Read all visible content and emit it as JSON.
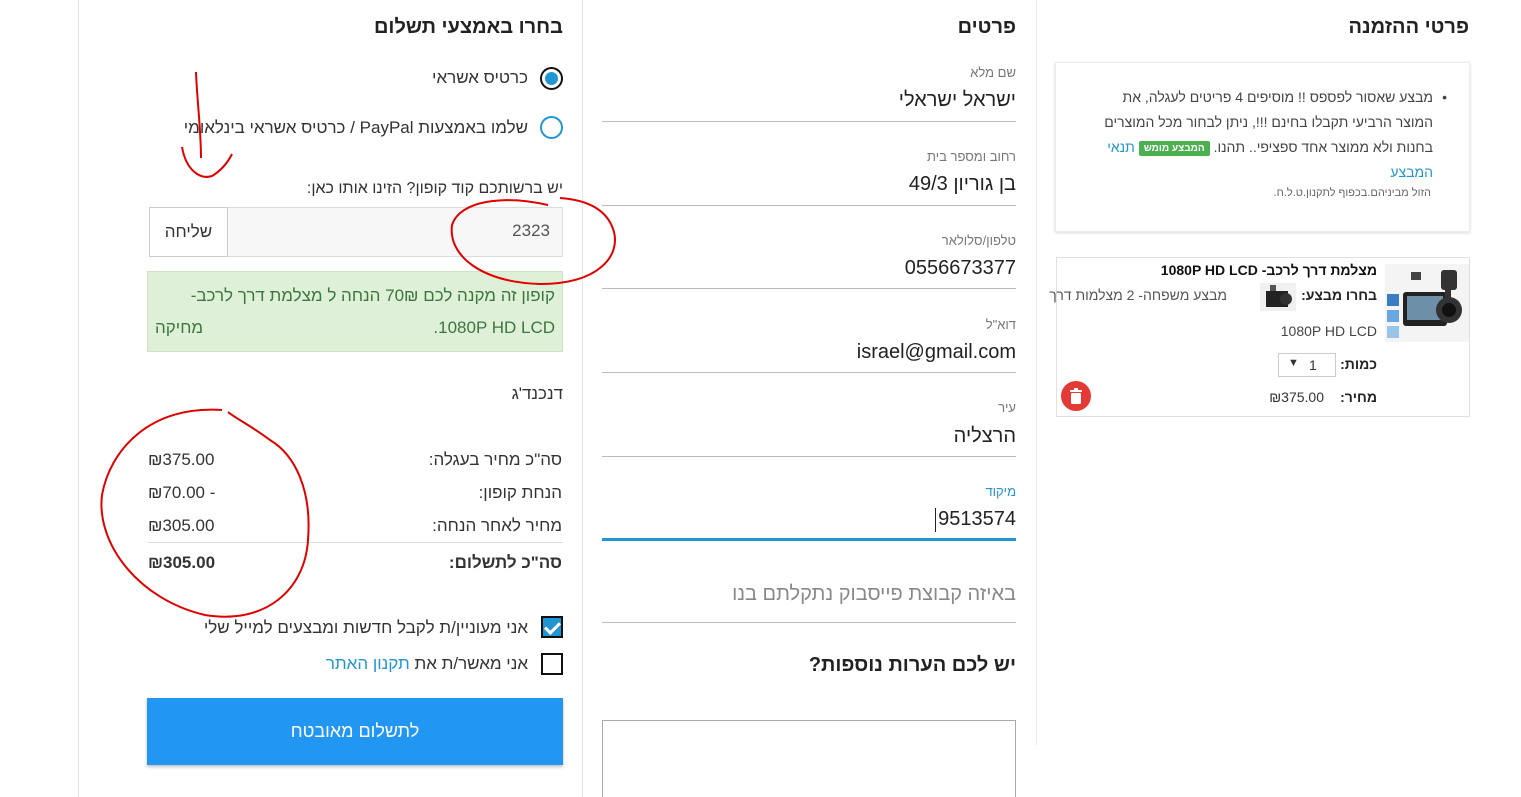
{
  "order": {
    "title": "פרטי ההזמנה",
    "promo_text": "מבצע שאסור לפספס !! מוסיפים 4 פריטים לעגלה, את המוצר הרביעי תקבלו בחינם !!!, ניתן לבחור מכל המוצרים בחנות ולא ממוצר אחד ספציפי.. תהנו.",
    "promo_badge": "המבצע מומש",
    "promo_terms_link": "תנאי המבצע",
    "promo_note": "הזול מביניהם.בכפוף לתקנון.ט.ל.ח.",
    "item": {
      "name": "מצלמת דרך לרכב- 1080P HD LCD",
      "choose_label": "בחרו מבצע:",
      "choose_value": "מבצע משפחה- 2 מצלמות דרך",
      "choose_value_2": "1080P HD LCD",
      "qty_label": "כמות:",
      "qty_value": "1",
      "price_label": "מחיר:",
      "price_value": "₪375.00"
    }
  },
  "details": {
    "title": "פרטים",
    "fields": [
      {
        "label": "שם מלא",
        "value": "ישראל ישראלי"
      },
      {
        "label": "רחוב ומספר בית",
        "value": "בן גוריון 49/3"
      },
      {
        "label": "טלפון/סלולאר",
        "value": "0556673377"
      },
      {
        "label": "דוא\"ל",
        "value": "israel@gmail.com"
      },
      {
        "label": "עיר",
        "value": "הרצליה"
      },
      {
        "label": "מיקוד",
        "value": "9513574"
      }
    ],
    "facebook_placeholder": "באיזה קבוצת פייסבוק נתקלתם בנו",
    "notes_title": "יש לכם הערות נוספות?"
  },
  "payment": {
    "title": "בחרו באמצעי תשלום",
    "option_card": "כרטיס אשראי",
    "option_paypal": "שלמו באמצעות PayPal / כרטיס אשראי בינלאומי",
    "coupon_prompt": "יש ברשותכם קוד קופון? הזינו אותו כאן:",
    "coupon_value": "2323",
    "coupon_send": "שליחה",
    "coupon_msg_line1": "קופון זה מקנה לכם 70₪ הנחה ל מצלמת דרך לרכב-",
    "coupon_msg_line2": "1080P HD LCD.",
    "coupon_delete": "מחיקה",
    "coupon_name": "דנכנד'ג",
    "summary": {
      "cart_label": "סה\"כ מחיר בעגלה:",
      "cart_value": "₪375.00",
      "discount_label": "הנחת קופון:",
      "discount_value": "₪70.00 -",
      "after_label": "מחיר לאחר הנחה:",
      "after_value": "₪305.00",
      "total_label": "סה\"כ לתשלום:",
      "total_value": "₪305.00"
    },
    "newsletter_label": "אני מעוניין/ת לקבל חדשות ומבצעים למייל שלי",
    "terms_prefix": "אני מאשר/ת את",
    "terms_link": "תקנון האתר",
    "pay_button": "לתשלום מאובטח"
  },
  "colors": {
    "accent": "#2196f3",
    "success_bg": "#dff0d8",
    "success_text": "#3c763d",
    "danger": "#e53935",
    "annotation": "#e00000"
  }
}
